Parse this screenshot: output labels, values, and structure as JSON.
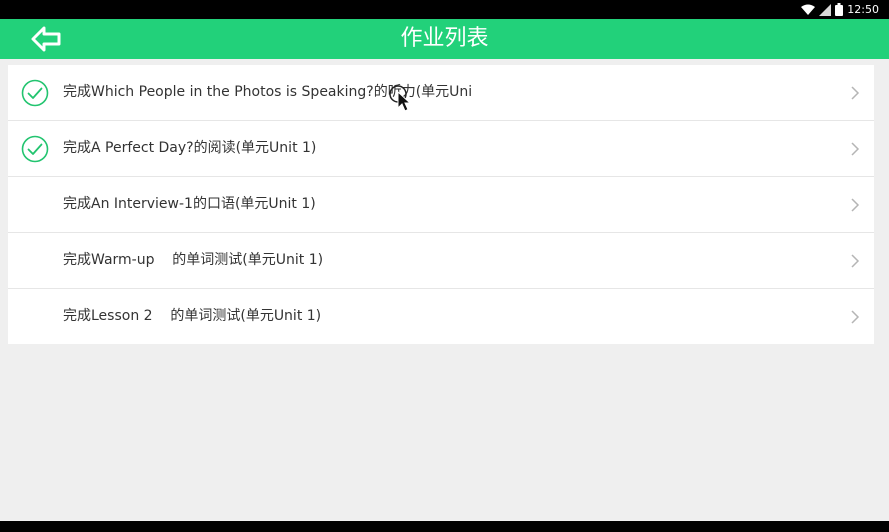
{
  "status_bar": {
    "time": "12:50",
    "icons": [
      "wifi-icon",
      "signal-icon",
      "battery-icon"
    ]
  },
  "app_bar": {
    "title": "作业列表",
    "back_icon": "arrow-left-icon",
    "color": "#22d17a"
  },
  "assignments": [
    {
      "label": "完成Which People in the Photos is Speaking?的听力(单元Uni",
      "completed": true
    },
    {
      "label": "完成A Perfect Day?的阅读(单元Unit 1)",
      "completed": true
    },
    {
      "label": "完成An Interview-1的口语(单元Unit 1)",
      "completed": false
    },
    {
      "label": "完成Warm-up    的单词测试(单元Unit 1)",
      "completed": false
    },
    {
      "label": "完成Lesson 2    的单词测试(单元Unit 1)",
      "completed": false
    }
  ]
}
